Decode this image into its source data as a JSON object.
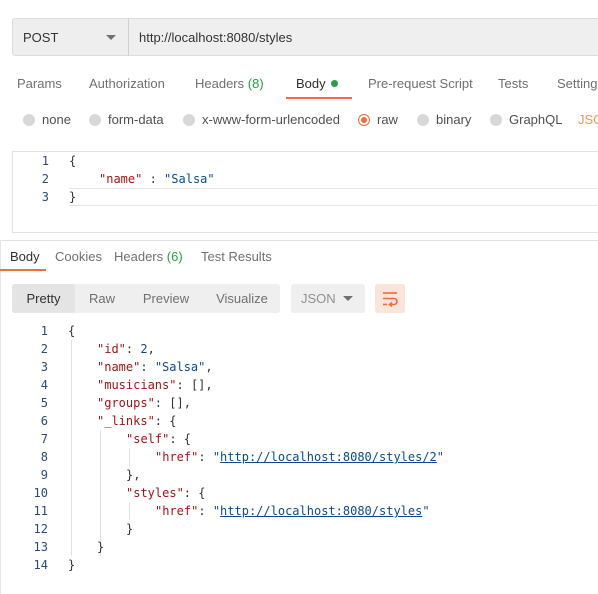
{
  "request": {
    "method": "POST",
    "url": "http://localhost:8080/styles"
  },
  "request_tabs": {
    "params": "Params",
    "authorization": "Authorization",
    "headers": "Headers",
    "headers_count": "(8)",
    "body": "Body",
    "prerequest": "Pre-request Script",
    "tests": "Tests",
    "settings": "Settings"
  },
  "body_types": {
    "none": "none",
    "form_data": "form-data",
    "urlencoded": "x-www-form-urlencoded",
    "raw": "raw",
    "binary": "binary",
    "graphql": "GraphQL",
    "json": "JSON",
    "selected": "raw"
  },
  "request_body": {
    "line_numbers": [
      "1",
      "2",
      "3"
    ],
    "open": "{",
    "key": "\"name\"",
    "sep": " : ",
    "value": "\"Salsa\"",
    "close": "}"
  },
  "response_tabs": {
    "body": "Body",
    "cookies": "Cookies",
    "headers": "Headers",
    "headers_count": "(6)",
    "test_results": "Test Results"
  },
  "response_toolbar": {
    "pretty": "Pretty",
    "raw": "Raw",
    "preview": "Preview",
    "visualize": "Visualize",
    "format": "JSON",
    "wrap_icon": "wrap-lines-icon"
  },
  "response_body": {
    "line_numbers": [
      "1",
      "2",
      "3",
      "4",
      "5",
      "6",
      "7",
      "8",
      "9",
      "10",
      "11",
      "12",
      "13",
      "14"
    ],
    "open": "{",
    "id_key": "\"id\"",
    "id_val": "2",
    "name_key": "\"name\"",
    "name_val": "\"Salsa\"",
    "musicians_key": "\"musicians\"",
    "musicians_val": "[]",
    "groups_key": "\"groups\"",
    "groups_val": "[]",
    "links_key": "\"_links\"",
    "self_key": "\"self\"",
    "href_key": "\"href\"",
    "self_href": "http://localhost:8080/styles/2",
    "styles_key": "\"styles\"",
    "styles_href": "http://localhost:8080/styles",
    "close": "}"
  },
  "colors": {
    "accent": "#f26b3a",
    "success": "#26a045",
    "key": "#a31515",
    "string": "#0b4b8f"
  }
}
